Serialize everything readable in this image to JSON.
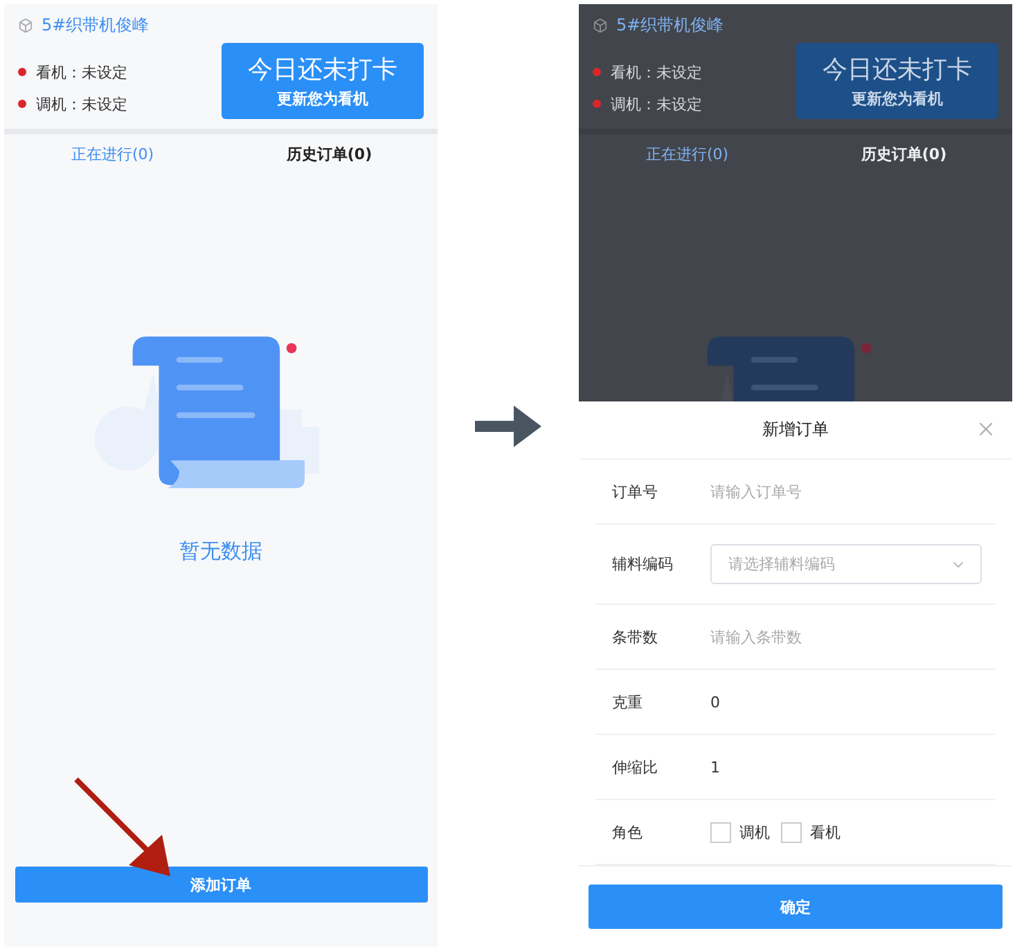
{
  "screens": [
    {
      "machine": {
        "name": "5#织带机俊峰"
      },
      "roles": [
        {
          "label": "看机：",
          "value": "未设定",
          "color": "#d9262c"
        },
        {
          "label": "调机：",
          "value": "未设定",
          "color": "#d9262c"
        }
      ],
      "checkin": {
        "title": "今日还未打卡",
        "subtitle": "更新您为看机"
      },
      "tabs": [
        {
          "label": "正在进行(0)",
          "selected": true
        },
        {
          "label": "历史订单(0)",
          "selected": false
        }
      ],
      "empty": {
        "text": "暂无数据"
      },
      "add_button": "添加订单",
      "dimmed": false
    },
    {
      "machine": {
        "name": "5#织带机俊峰"
      },
      "roles": [
        {
          "label": "看机：",
          "value": "未设定",
          "color": "#d9262c"
        },
        {
          "label": "调机：",
          "value": "未设定",
          "color": "#d9262c"
        }
      ],
      "checkin": {
        "title": "今日还未打卡",
        "subtitle": "更新您为看机"
      },
      "tabs": [
        {
          "label": "正在进行(0)",
          "selected": true
        },
        {
          "label": "历史订单(0)",
          "selected": false
        }
      ],
      "dimmed": true,
      "dialog": {
        "title": "新增订单",
        "fields": [
          {
            "kind": "input",
            "label": "订单号",
            "placeholder": "请输入订单号"
          },
          {
            "kind": "select",
            "label": "辅料编码",
            "placeholder": "请选择辅料编码"
          },
          {
            "kind": "input",
            "label": "条带数",
            "placeholder": "请输入条带数"
          },
          {
            "kind": "input",
            "label": "克重",
            "value": "0"
          },
          {
            "kind": "input",
            "label": "伸缩比",
            "value": "1"
          },
          {
            "kind": "checkboxes",
            "label": "角色",
            "options": [
              {
                "label": "调机",
                "checked": false
              },
              {
                "label": "看机",
                "checked": false
              }
            ]
          }
        ],
        "confirm": "确定"
      }
    }
  ]
}
